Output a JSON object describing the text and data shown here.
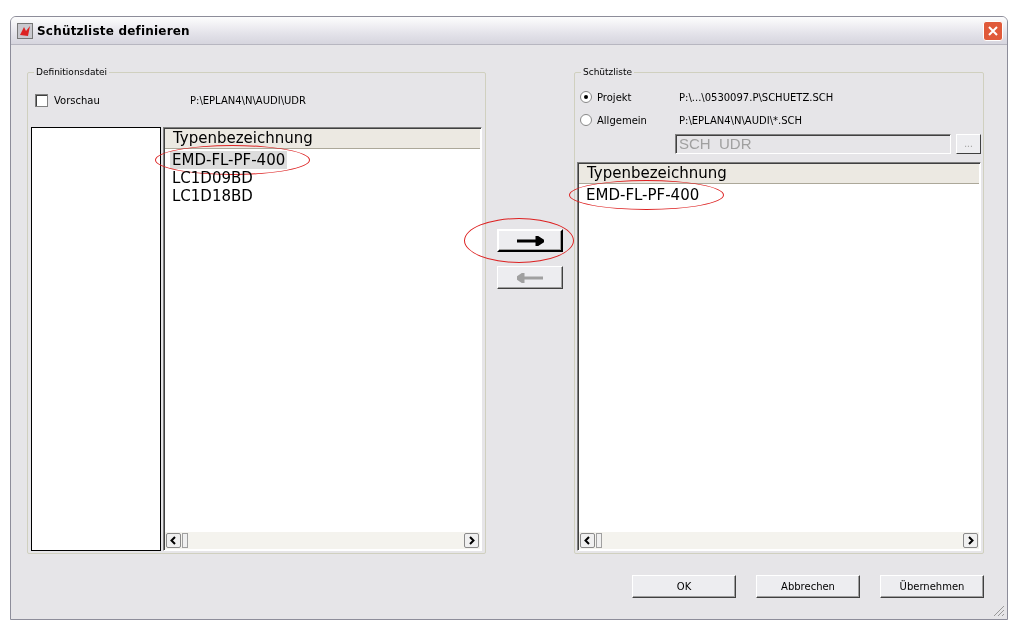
{
  "window": {
    "title": "Schützliste definieren"
  },
  "definition_file": {
    "label": "Definitionsdatei",
    "preview": {
      "label": "Vorschau",
      "checked": false
    },
    "path": "P:\\EPLAN4\\N\\AUDI\\UDR",
    "list": {
      "column": "Typenbezeichnung",
      "items": [
        {
          "text": "EMD-FL-PF-400",
          "selected": true,
          "highlighted": true
        },
        {
          "text": "LC1D09BD",
          "selected": false,
          "highlighted": false
        },
        {
          "text": "LC1D18BD",
          "selected": false,
          "highlighted": false
        }
      ]
    }
  },
  "transfer_buttons": [
    {
      "kind": "arrow-right",
      "disabled": false,
      "highlighted": true
    },
    {
      "kind": "arrow-left",
      "disabled": true,
      "highlighted": false
    }
  ],
  "contactor_list": {
    "label": "Schützliste",
    "sources": [
      {
        "label": "Projekt",
        "selected": true,
        "path": "P:\\...\\0530097.P\\SCHUETZ.SCH"
      },
      {
        "label": "Allgemein",
        "selected": false,
        "path": "P:\\EPLAN4\\N\\AUDI\\*.SCH"
      }
    ],
    "field": {
      "value": "SCH  UDR",
      "disabled": true
    },
    "browse_button": "...",
    "list": {
      "column": "Typenbezeichnung",
      "items": [
        {
          "text": "EMD-FL-PF-400",
          "selected": false,
          "highlighted": true
        }
      ]
    }
  },
  "buttons": [
    "OK",
    "Abbrechen",
    "Übernehmen"
  ]
}
